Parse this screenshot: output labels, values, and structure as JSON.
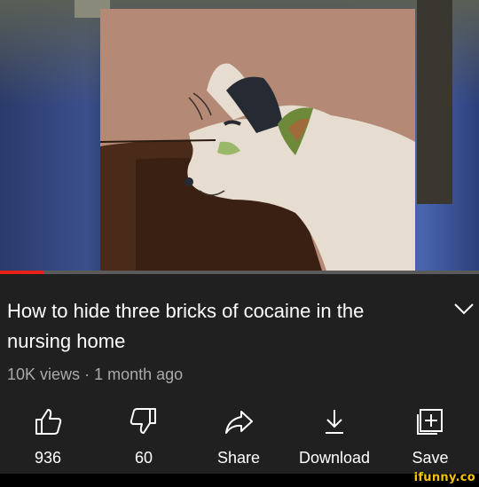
{
  "video": {
    "progress_fraction": 0.09
  },
  "title": "How to hide three bricks of cocaine in the nursing home",
  "meta": {
    "views": "10K views",
    "separator": "·",
    "age": "1 month ago"
  },
  "actions": [
    {
      "id": "like",
      "icon": "thumbs-up-icon",
      "label": "936"
    },
    {
      "id": "dislike",
      "icon": "thumbs-down-icon",
      "label": "60"
    },
    {
      "id": "share",
      "icon": "share-arrow-icon",
      "label": "Share"
    },
    {
      "id": "download",
      "icon": "download-icon",
      "label": "Download"
    },
    {
      "id": "save",
      "icon": "save-playlist-icon",
      "label": "Save"
    }
  ],
  "watermark": "ifunny.co",
  "colors": {
    "background": "#202020",
    "progress_played": "#e62117",
    "meta_text": "#aaaaaa",
    "watermark": "#f5c400"
  }
}
